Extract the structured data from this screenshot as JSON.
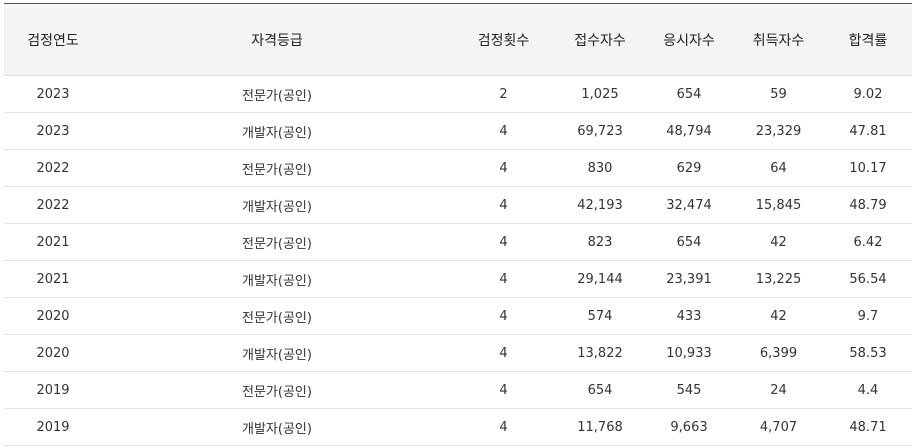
{
  "table": {
    "headers": [
      "검정연도",
      "자격등급",
      "검정횟수",
      "접수자수",
      "응시자수",
      "취득자수",
      "합격률"
    ],
    "rows": [
      [
        "2023",
        "전문가(공인)",
        "2",
        "1,025",
        "654",
        "59",
        "9.02"
      ],
      [
        "2023",
        "개발자(공인)",
        "4",
        "69,723",
        "48,794",
        "23,329",
        "47.81"
      ],
      [
        "2022",
        "전문가(공인)",
        "4",
        "830",
        "629",
        "64",
        "10.17"
      ],
      [
        "2022",
        "개발자(공인)",
        "4",
        "42,193",
        "32,474",
        "15,845",
        "48.79"
      ],
      [
        "2021",
        "전문가(공인)",
        "4",
        "823",
        "654",
        "42",
        "6.42"
      ],
      [
        "2021",
        "개발자(공인)",
        "4",
        "29,144",
        "23,391",
        "13,225",
        "56.54"
      ],
      [
        "2020",
        "전문가(공인)",
        "4",
        "574",
        "433",
        "42",
        "9.7"
      ],
      [
        "2020",
        "개발자(공인)",
        "4",
        "13,822",
        "10,933",
        "6,399",
        "58.53"
      ],
      [
        "2019",
        "전문가(공인)",
        "4",
        "654",
        "545",
        "24",
        "4.4"
      ],
      [
        "2019",
        "개발자(공인)",
        "4",
        "11,768",
        "9,663",
        "4,707",
        "48.71"
      ]
    ]
  },
  "colors": {
    "header_bg": "#f4f4f5",
    "row_border": "#e2e2e2",
    "top_border": "#5a5a5a"
  }
}
